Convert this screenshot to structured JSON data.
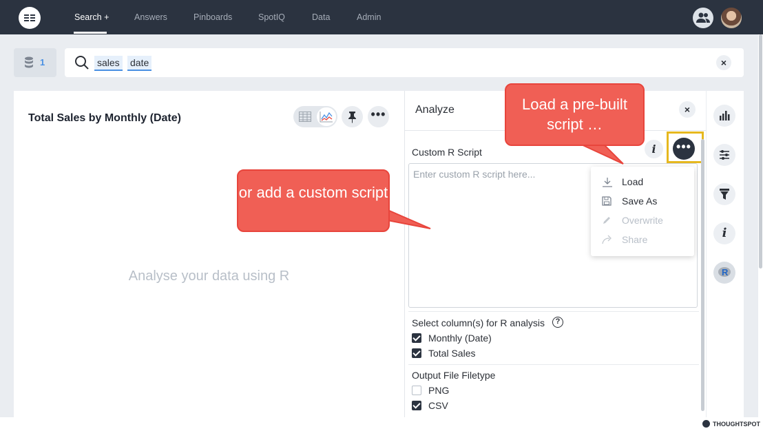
{
  "nav": {
    "items": [
      {
        "label": "Search +",
        "active": true
      },
      {
        "label": "Answers"
      },
      {
        "label": "Pinboards"
      },
      {
        "label": "SpotIQ"
      },
      {
        "label": "Data"
      },
      {
        "label": "Admin"
      }
    ]
  },
  "search": {
    "source_count": "1",
    "tokens": [
      "sales",
      "date"
    ],
    "clear_label": "×"
  },
  "card": {
    "title": "Total Sales by Monthly (Date)",
    "placeholder": "Analyse your data using R"
  },
  "panel": {
    "title": "Analyze",
    "close_label": "×",
    "script_label": "Custom R Script",
    "info_label": "i",
    "script_placeholder": "Enter custom R script here...",
    "menu": [
      {
        "label": "Load",
        "icon": "download-icon",
        "enabled": true
      },
      {
        "label": "Save As",
        "icon": "save-icon",
        "enabled": true
      },
      {
        "label": "Overwrite",
        "icon": "pencil-icon",
        "enabled": false
      },
      {
        "label": "Share",
        "icon": "share-icon",
        "enabled": false
      }
    ],
    "columns_label": "Select column(s) for R analysis",
    "help_label": "?",
    "columns": [
      {
        "label": "Monthly (Date)",
        "checked": true
      },
      {
        "label": "Total Sales",
        "checked": true
      }
    ],
    "filetype_label": "Output File Filetype",
    "filetypes": [
      {
        "label": "PNG",
        "checked": false
      },
      {
        "label": "CSV",
        "checked": true
      }
    ]
  },
  "rail": {
    "info_label": "i",
    "r_label": "R"
  },
  "footer": {
    "brand": "THOUGHTSPOT"
  },
  "callouts": {
    "load": "Load a pre-built script …",
    "custom": "or add a custom script"
  },
  "colors": {
    "nav_bg": "#2b3340",
    "accent": "#4a90e2",
    "callout": "#f05f55",
    "highlight": "#e6b81e"
  }
}
